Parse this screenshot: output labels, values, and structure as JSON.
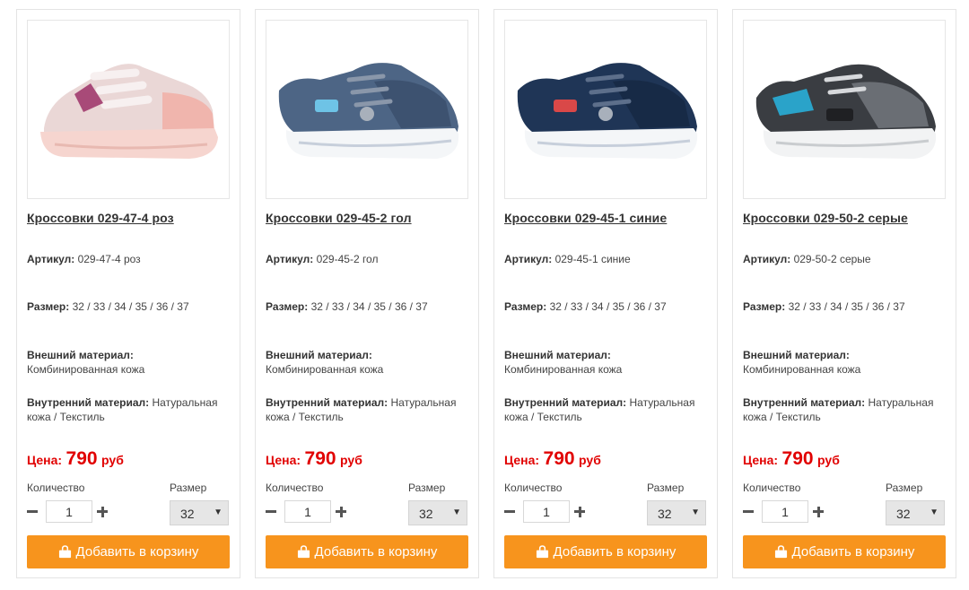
{
  "labels": {
    "article": "Артикул:",
    "size": "Размер:",
    "outer_material": "Внешний материал:",
    "inner_material": "Внутренний материал:",
    "price": "Цена:",
    "quantity": "Количество",
    "size_select": "Размер",
    "add_to_cart": "Добавить в корзину",
    "currency": "руб",
    "caret": "▼"
  },
  "colors": {
    "button": "#f7941d",
    "price": "#e10000",
    "text": "#333333"
  },
  "products": [
    {
      "title": "Кроссовки 029-47-4 роз",
      "article": "029-47-4 роз",
      "sizes": "32 / 33 / 34 / 35 / 36 / 37",
      "outer_material": "Комбинированная кожа",
      "inner_material": "Натуральная кожа / Текстиль",
      "price": "790",
      "quantity": "1",
      "selected_size": "32",
      "shoe_color": "pink"
    },
    {
      "title": "Кроссовки 029-45-2 гол",
      "article": "029-45-2 гол",
      "sizes": "32 / 33 / 34 / 35 / 36 / 37",
      "outer_material": "Комбинированная кожа",
      "inner_material": "Натуральная кожа / Текстиль",
      "price": "790",
      "quantity": "1",
      "selected_size": "32",
      "shoe_color": "steel-blue"
    },
    {
      "title": "Кроссовки 029-45-1 синие",
      "article": "029-45-1 синие",
      "sizes": "32 / 33 / 34 / 35 / 36 / 37",
      "outer_material": "Комбинированная кожа",
      "inner_material": "Натуральная кожа / Текстиль",
      "price": "790",
      "quantity": "1",
      "selected_size": "32",
      "shoe_color": "navy"
    },
    {
      "title": "Кроссовки 029-50-2 серые",
      "article": "029-50-2 серые",
      "sizes": "32 / 33 / 34 / 35 / 36 / 37",
      "outer_material": "Комбинированная кожа",
      "inner_material": "Натуральная кожа / Текстиль",
      "price": "790",
      "quantity": "1",
      "selected_size": "32",
      "shoe_color": "grey"
    }
  ]
}
